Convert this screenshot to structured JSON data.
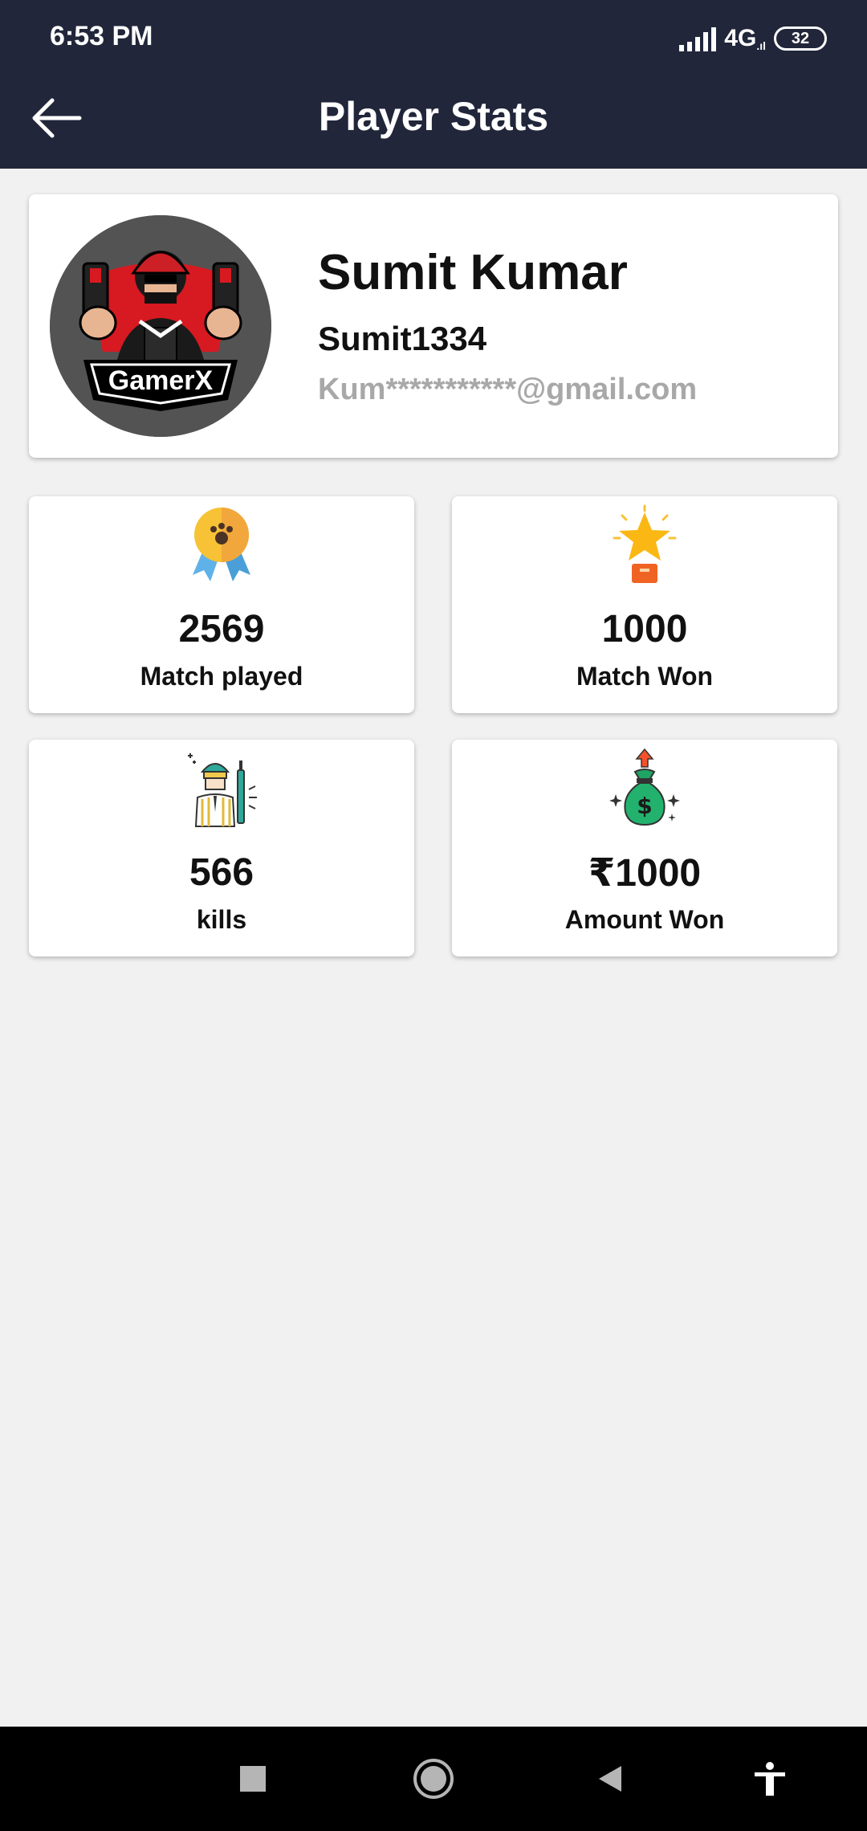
{
  "status_bar": {
    "time": "6:53 PM",
    "network": "4G",
    "battery": "32"
  },
  "app_bar": {
    "title": "Player Stats",
    "back_icon": "arrow-left-icon"
  },
  "profile": {
    "name": "Sumit Kumar",
    "username": "Sumit1334",
    "email": "Kum***********@gmail.com",
    "avatar_text": "GamerX"
  },
  "stats": [
    {
      "value": "2569",
      "label": "Match played",
      "icon": "medal-icon"
    },
    {
      "value": "1000",
      "label": "Match Won",
      "icon": "star-trophy-icon"
    },
    {
      "value": "566",
      "label": "kills",
      "icon": "soldier-icon"
    },
    {
      "value": "₹1000",
      "label": "Amount Won",
      "icon": "money-bag-icon"
    }
  ],
  "colors": {
    "app_bar": "#21263a",
    "background": "#f1f1f1",
    "email_text": "#a8a8a8"
  }
}
